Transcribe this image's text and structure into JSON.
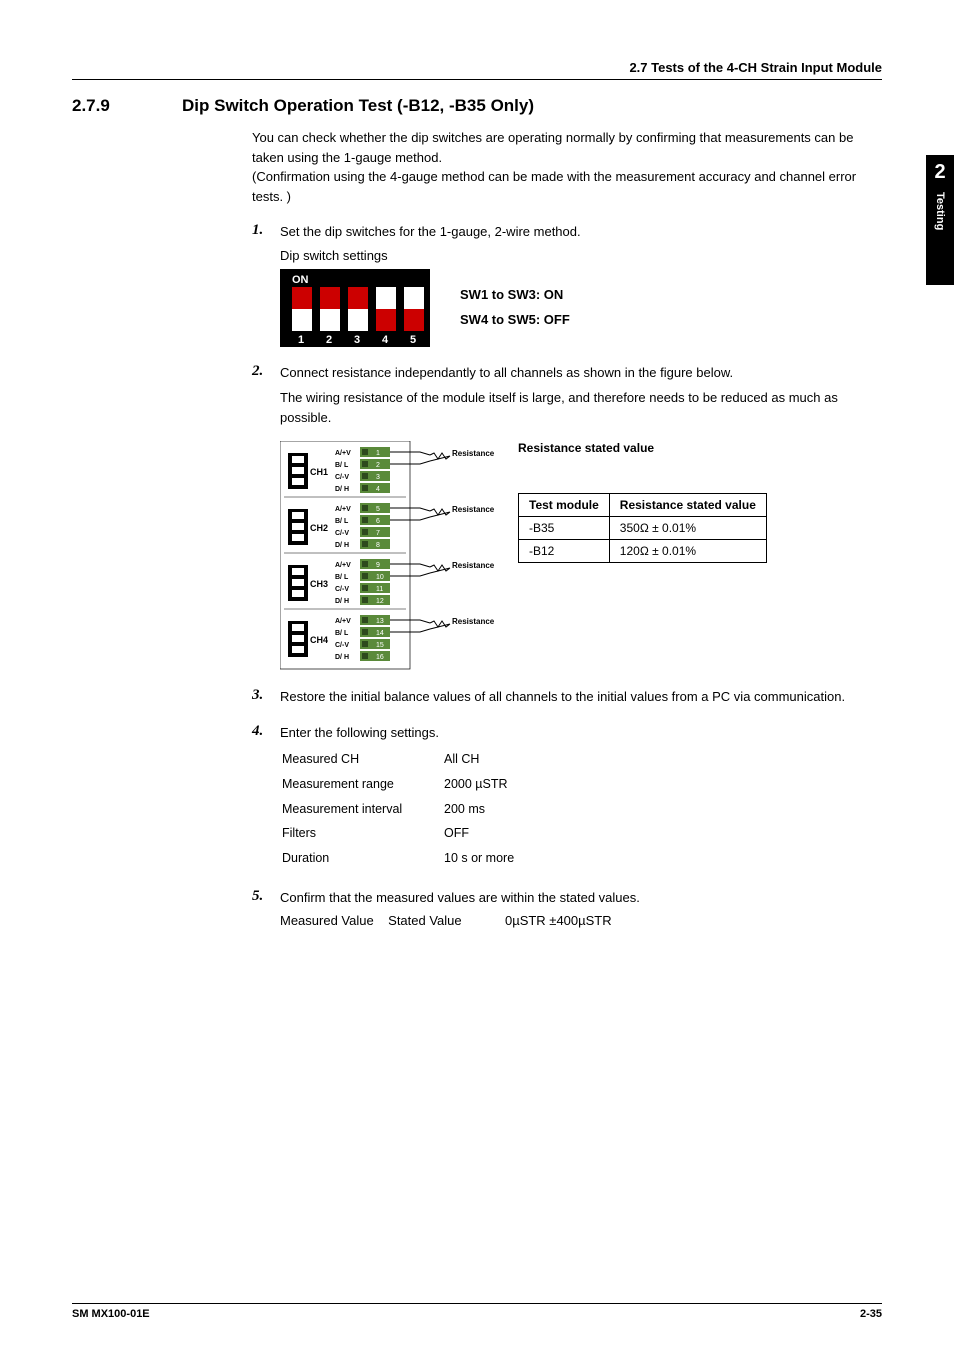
{
  "header": {
    "section_ref": "2.7  Tests of the 4-CH Strain Input Module"
  },
  "sidetab": {
    "chapter_num": "2",
    "chapter_title": "Testing"
  },
  "section": {
    "number": "2.7.9",
    "title": "Dip Switch Operation Test  (-B12, -B35 Only)"
  },
  "intro": {
    "p1": "You can check whether the dip switches are operating normally by confirming that measurements can be taken using the 1-gauge method.",
    "p2": " (Confirmation using the 4-gauge method can be made with the measurement accuracy and channel error tests. )"
  },
  "steps": {
    "s1": {
      "num": "1.",
      "text": "Set the dip switches for the 1-gauge, 2-wire method.",
      "sub": "Dip switch settings"
    },
    "s2": {
      "num": "2.",
      "text": "Connect resistance independantly to all channels as shown in the figure below.",
      "text2": "The wiring resistance of the module itself is large, and therefore needs to be reduced as much as possible."
    },
    "s3": {
      "num": "3.",
      "text": "Restore the initial balance values of all channels to the initial values from a PC via communication."
    },
    "s4": {
      "num": "4.",
      "text": "Enter the following settings."
    },
    "s5": {
      "num": "5.",
      "text": "Confirm that the measured values are within the stated values.",
      "line": "Measured Value    Stated Value            0µSTR ±400µSTR"
    }
  },
  "dip": {
    "on_label": "ON",
    "nums": [
      "1",
      "2",
      "3",
      "4",
      "5"
    ],
    "line1": "SW1 to SW3: ON",
    "line2": "SW4 to SW5: OFF"
  },
  "diagram": {
    "ch_labels": [
      "CH1",
      "CH2",
      "CH3",
      "CH4"
    ],
    "pin_labels": [
      "A/+V",
      "B/ L",
      "C/-V",
      "D/ H"
    ],
    "res_label": "Resistance"
  },
  "res_table": {
    "caption": "Resistance stated value",
    "h1": "Test module",
    "h2": "Resistance stated value",
    "r1c1": "-B35",
    "r1c2": "350Ω ± 0.01%",
    "r2c1": "-B12",
    "r2c2": "120Ω ± 0.01%"
  },
  "settings": {
    "r1k": "Measured CH",
    "r1v": "All CH",
    "r2k": "Measurement range",
    "r2v": "2000 µSTR",
    "r3k": "Measurement interval",
    "r3v": "200 ms",
    "r4k": "Filters",
    "r4v": "OFF",
    "r5k": "Duration",
    "r5v": "10 s or more"
  },
  "footer": {
    "left": "SM MX100-01E",
    "right": "2-35"
  },
  "chart_data": {
    "type": "table",
    "title": "Resistance stated value",
    "columns": [
      "Test module",
      "Resistance stated value"
    ],
    "rows": [
      [
        "-B35",
        "350Ω ± 0.01%"
      ],
      [
        "-B12",
        "120Ω ± 0.01%"
      ]
    ]
  }
}
